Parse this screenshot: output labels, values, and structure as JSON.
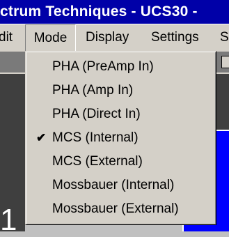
{
  "window": {
    "title": "ctrum Techniques - UCS30 -"
  },
  "menubar": {
    "items": [
      {
        "label": "dit"
      },
      {
        "label": "Mode"
      },
      {
        "label": "Display"
      },
      {
        "label": "Settings"
      },
      {
        "label": "S"
      }
    ]
  },
  "mode_menu": {
    "items": [
      {
        "label": "PHA (PreAmp In)",
        "checked": false
      },
      {
        "label": "PHA (Amp In)",
        "checked": false
      },
      {
        "label": "PHA (Direct In)",
        "checked": false
      },
      {
        "label": "MCS (Internal)",
        "checked": true,
        "check_mark": "✔"
      },
      {
        "label": "MCS (External)",
        "checked": false
      },
      {
        "label": "Mossbauer (Internal)",
        "checked": false
      },
      {
        "label": "Mossbauer (External)",
        "checked": false
      }
    ]
  },
  "background": {
    "left_digit": "1"
  },
  "colors": {
    "titlebar": "#0000a8",
    "menu_bg": "#d4d0c8",
    "blue_panel": "#0000ff"
  }
}
